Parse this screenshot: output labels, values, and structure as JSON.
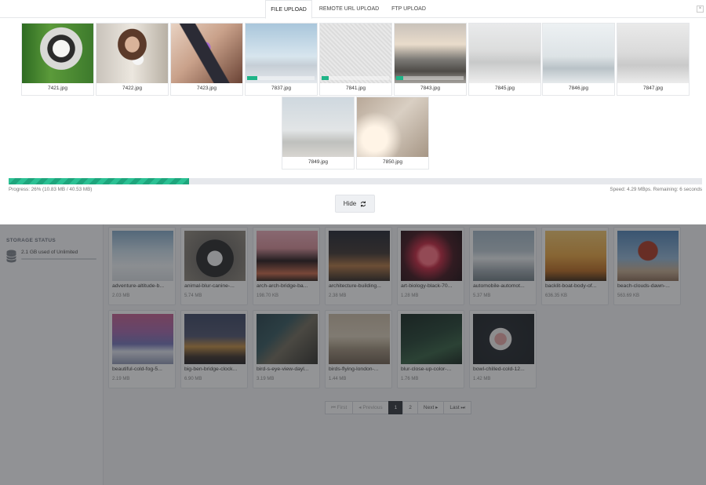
{
  "tabs": [
    {
      "label": "FILE UPLOAD",
      "active": true
    },
    {
      "label": "REMOTE URL UPLOAD",
      "active": false
    },
    {
      "label": "FTP UPLOAD",
      "active": false
    }
  ],
  "close_label": "×",
  "uploads": [
    {
      "name": "7421.jpg",
      "progress": 100
    },
    {
      "name": "7422.jpg",
      "progress": 100
    },
    {
      "name": "7423.jpg",
      "progress": 100
    },
    {
      "name": "7837.jpg",
      "progress": 15
    },
    {
      "name": "7841.jpg",
      "progress": 10
    },
    {
      "name": "7843.jpg",
      "progress": 10
    },
    {
      "name": "7845.jpg",
      "progress": 0
    },
    {
      "name": "7846.jpg",
      "progress": 0
    },
    {
      "name": "7847.jpg",
      "progress": 0
    },
    {
      "name": "7849.jpg",
      "progress": 0
    },
    {
      "name": "7850.jpg",
      "progress": 0
    }
  ],
  "progress": {
    "percent": 26,
    "text": "Progress: 26% (10.83 MB / 40.53 MB)",
    "speed_text": "Speed: 4.29 MBps. Remaining: 6 seconds"
  },
  "hide_button": {
    "label": "Hide"
  },
  "storage": {
    "title": "STORAGE STATUS",
    "text": "2.1 GB used of Unlimited"
  },
  "files": [
    {
      "name": "adventure-altitude-b...",
      "size": "2.03 MB"
    },
    {
      "name": "animal-blur-canine-...",
      "size": "5.74 MB"
    },
    {
      "name": "arch-arch-bridge-ba...",
      "size": "198.70 KB"
    },
    {
      "name": "architecture-building...",
      "size": "2.38 MB"
    },
    {
      "name": "art-biology-black-70...",
      "size": "1.28 MB"
    },
    {
      "name": "automobile-automot...",
      "size": "5.37 MB"
    },
    {
      "name": "backlit-boat-body-of...",
      "size": "636.35 KB"
    },
    {
      "name": "beach-clouds-dawn-...",
      "size": "563.69 KB"
    },
    {
      "name": "beautiful-cold-fog-5...",
      "size": "2.19 MB"
    },
    {
      "name": "big-ben-bridge-clock...",
      "size": "6.90 MB"
    },
    {
      "name": "bird-s-eye-view-dayl...",
      "size": "3.19 MB"
    },
    {
      "name": "birds-flying-london-...",
      "size": "1.44 MB"
    },
    {
      "name": "blur-close-up-color-...",
      "size": "1.76 MB"
    },
    {
      "name": "bowl-chilled-cold-12...",
      "size": "1.42 MB"
    }
  ],
  "pagination": {
    "first": "⏮ First",
    "previous": "◂ Previous",
    "pages": [
      "1",
      "2"
    ],
    "current": "1",
    "next": "Next ▸",
    "last": "Last ⏭"
  },
  "colors": {
    "accent": "#1fb487",
    "overlay": "#282a2e",
    "active_page": "#2c3036"
  }
}
